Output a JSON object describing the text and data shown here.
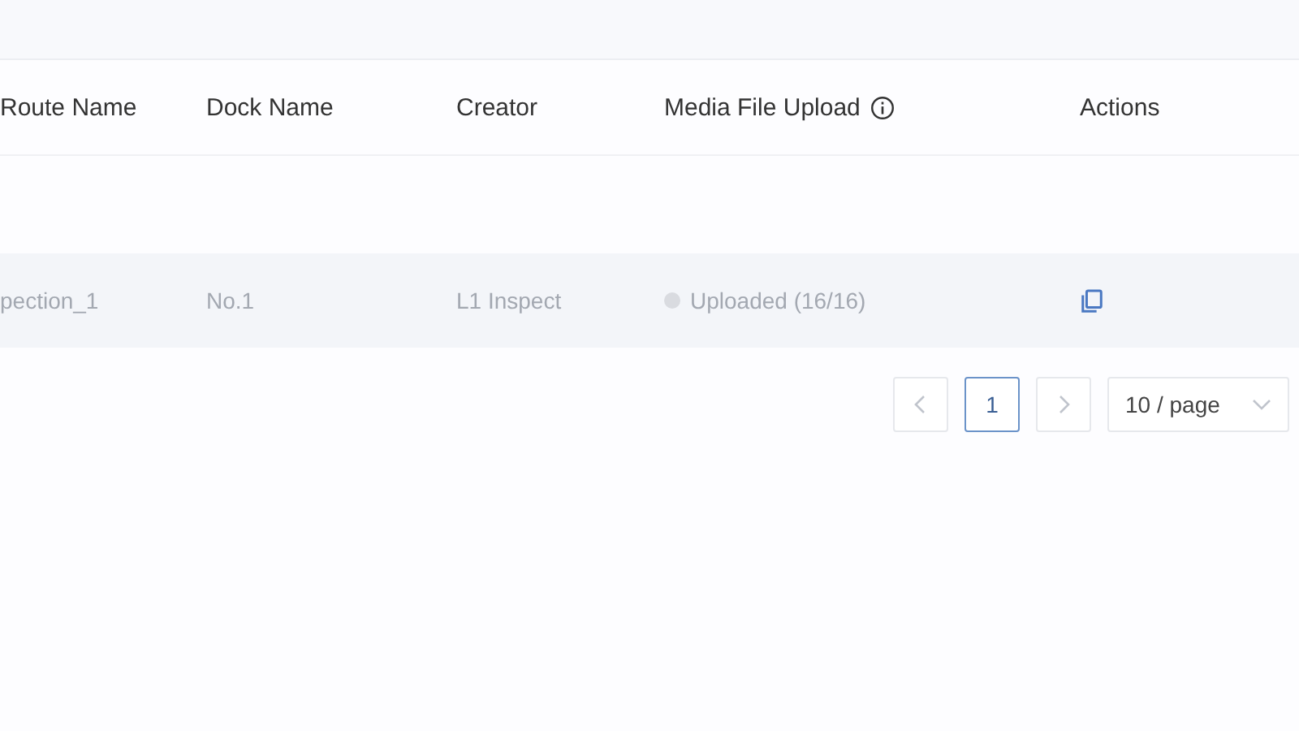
{
  "table": {
    "columns": [
      "Route Name",
      "Dock Name",
      "Creator",
      "Media File Upload",
      "Actions"
    ],
    "rows": [
      {
        "route_name": "pection_1",
        "dock_name": "No.1",
        "creator": "L1 Inspect",
        "media_upload": "Uploaded (16/16)"
      }
    ]
  },
  "pagination": {
    "pages": [
      {
        "label": "1",
        "selected": true
      }
    ],
    "page_size": "10 / page"
  }
}
